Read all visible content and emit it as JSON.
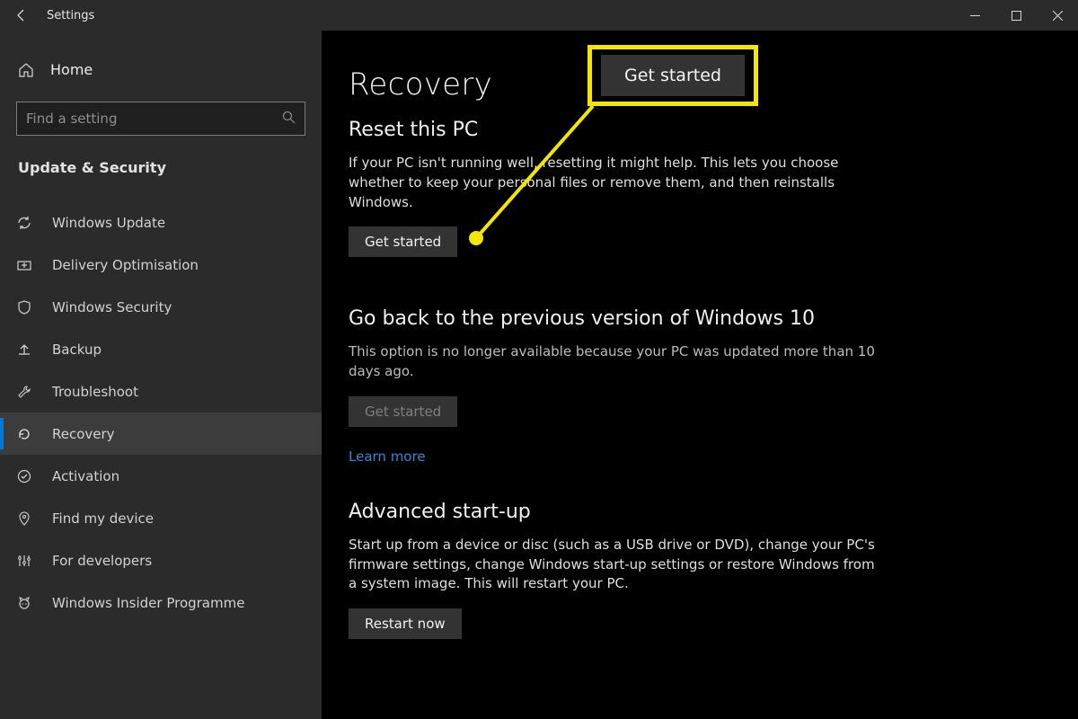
{
  "window": {
    "title": "Settings"
  },
  "sidebar": {
    "home_label": "Home",
    "search_placeholder": "Find a setting",
    "section_title": "Update & Security",
    "items": [
      {
        "label": "Windows Update"
      },
      {
        "label": "Delivery Optimisation"
      },
      {
        "label": "Windows Security"
      },
      {
        "label": "Backup"
      },
      {
        "label": "Troubleshoot"
      },
      {
        "label": "Recovery"
      },
      {
        "label": "Activation"
      },
      {
        "label": "Find my device"
      },
      {
        "label": "For developers"
      },
      {
        "label": "Windows Insider Programme"
      }
    ]
  },
  "main": {
    "page_title": "Recovery",
    "reset": {
      "heading": "Reset this PC",
      "body": "If your PC isn't running well, resetting it might help. This lets you choose whether to keep your personal files or remove them, and then reinstalls Windows.",
      "button": "Get started"
    },
    "goback": {
      "heading": "Go back to the previous version of Windows 10",
      "body": "This option is no longer available because your PC was updated more than 10 days ago.",
      "button": "Get started",
      "learn_more": "Learn more"
    },
    "advanced": {
      "heading": "Advanced start-up",
      "body": "Start up from a device or disc (such as a USB drive or DVD), change your PC's firmware settings, change Windows start-up settings or restore Windows from a system image. This will restart your PC.",
      "button": "Restart now"
    }
  },
  "callout": {
    "label": "Get started"
  }
}
